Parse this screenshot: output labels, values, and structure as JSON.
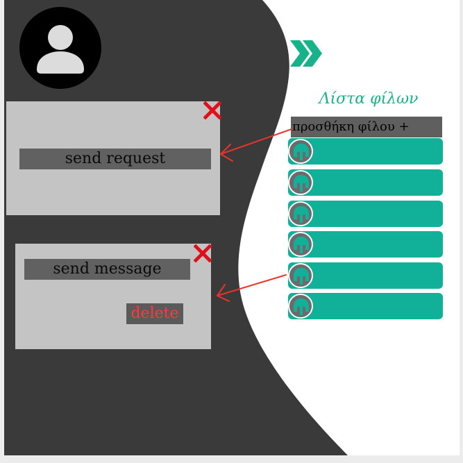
{
  "profile": {
    "avatar_icon": "user-silhouette-icon"
  },
  "nav": {
    "expand_icon": "double-chevron-right-icon"
  },
  "friends": {
    "title": "Λίστα φίλων",
    "add_label": "προσθήκη φίλου  +",
    "items": [
      {
        "avatar_icon": "helmet-icon"
      },
      {
        "avatar_icon": "helmet-icon"
      },
      {
        "avatar_icon": "helmet-icon"
      },
      {
        "avatar_icon": "helmet-icon"
      },
      {
        "avatar_icon": "helmet-icon"
      },
      {
        "avatar_icon": "helmet-icon"
      }
    ]
  },
  "request_panel": {
    "button_label": "send request",
    "close_icon": "close-icon"
  },
  "message_panel": {
    "send_label": "send message",
    "delete_label": "delete",
    "close_icon": "close-icon"
  },
  "colors": {
    "dark": "#3a3a3a",
    "accent": "#11b199",
    "title_green": "#16b38a",
    "close_red": "#e0101a",
    "arrow_red": "#e8342a",
    "panel": "#c4c4c4",
    "button": "#616161"
  }
}
